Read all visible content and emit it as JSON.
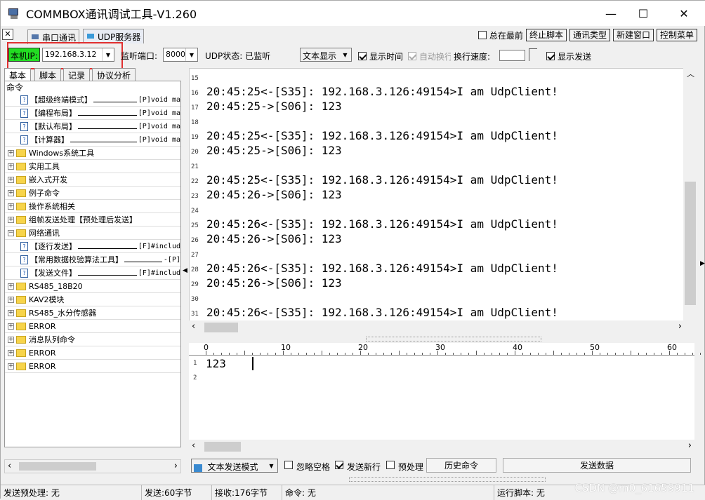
{
  "window": {
    "title": "COMMBOX通讯调试工具-V1.260"
  },
  "tabs": [
    {
      "label": "串口通讯"
    },
    {
      "label": "UDP服务器"
    }
  ],
  "top_right": {
    "always_on_top": "总在最前",
    "buttons": [
      "终止脚本",
      "通讯类型",
      "新建窗口",
      "控制菜单"
    ]
  },
  "toolbar": {
    "local_ip_label": "本机IP:",
    "local_ip_value": "192.168.3.12",
    "listen_port_label": "监听端口:",
    "listen_port_value": "8000",
    "udp_status": "UDP状态: 已监听",
    "display_mode": "文本显示",
    "show_time": "显示时间",
    "auto_wrap": "自动换行",
    "wrap_speed_label": "换行速度:",
    "show_send": "显示发送"
  },
  "left_tabs": [
    {
      "label": "基本"
    },
    {
      "label": "脚本"
    },
    {
      "label": "记录"
    },
    {
      "label": "协议分析"
    }
  ],
  "tree": {
    "header": "命令",
    "items": [
      {
        "kind": "doc",
        "label": "【超级终端模式】",
        "tail": "[P]void ma"
      },
      {
        "kind": "doc",
        "label": "【编程布局】",
        "tail": "[P]void ma"
      },
      {
        "kind": "doc",
        "label": "【默认布局】",
        "tail": "[P]void ma"
      },
      {
        "kind": "doc",
        "label": "【计算器】",
        "tail": "[P]void ma"
      },
      {
        "kind": "folder",
        "label": "Windows系统工具",
        "tail": ""
      },
      {
        "kind": "folder",
        "label": "实用工具",
        "tail": ""
      },
      {
        "kind": "folder",
        "label": "嵌入式开发",
        "tail": ""
      },
      {
        "kind": "folder",
        "label": "例子命令",
        "tail": ""
      },
      {
        "kind": "folder",
        "label": "操作系统相关",
        "tail": ""
      },
      {
        "kind": "folder",
        "label": "组帧发送处理【预处理后发送】",
        "tail": ""
      },
      {
        "kind": "folder-open",
        "label": "网络通讯",
        "tail": ""
      },
      {
        "kind": "doc",
        "label": "【逐行发送】",
        "tail": "[F]#includ"
      },
      {
        "kind": "doc",
        "label": "【常用数据校验算法工具】",
        "tail": "-[P]"
      },
      {
        "kind": "doc",
        "label": "【发送文件】",
        "tail": "[F]#includ"
      },
      {
        "kind": "folder",
        "label": "RS485_18B20",
        "tail": ""
      },
      {
        "kind": "folder",
        "label": "KAV2模块",
        "tail": ""
      },
      {
        "kind": "folder",
        "label": "RS485_水分传感器",
        "tail": ""
      },
      {
        "kind": "folder",
        "label": "ERROR",
        "tail": ""
      },
      {
        "kind": "folder",
        "label": "消息队列命令",
        "tail": ""
      },
      {
        "kind": "folder",
        "label": "ERROR",
        "tail": ""
      },
      {
        "kind": "folder",
        "label": "ERROR",
        "tail": ""
      }
    ]
  },
  "output": {
    "lines": [
      {
        "n": "15",
        "text": ""
      },
      {
        "n": "16",
        "text": "20:45:25<-[S35]: 192.168.3.126:49154>I am UdpClient!"
      },
      {
        "n": "17",
        "text": "20:45:25->[S06]: 123"
      },
      {
        "n": "18",
        "text": ""
      },
      {
        "n": "19",
        "text": "20:45:25<-[S35]: 192.168.3.126:49154>I am UdpClient!"
      },
      {
        "n": "20",
        "text": "20:45:25->[S06]: 123"
      },
      {
        "n": "21",
        "text": ""
      },
      {
        "n": "22",
        "text": "20:45:25<-[S35]: 192.168.3.126:49154>I am UdpClient!"
      },
      {
        "n": "23",
        "text": "20:45:26->[S06]: 123"
      },
      {
        "n": "24",
        "text": ""
      },
      {
        "n": "25",
        "text": "20:45:26<-[S35]: 192.168.3.126:49154>I am UdpClient!"
      },
      {
        "n": "26",
        "text": "20:45:26->[S06]: 123"
      },
      {
        "n": "27",
        "text": ""
      },
      {
        "n": "28",
        "text": "20:45:26<-[S35]: 192.168.3.126:49154>I am UdpClient!"
      },
      {
        "n": "29",
        "text": "20:45:26->[S06]: 123"
      },
      {
        "n": "30",
        "text": ""
      },
      {
        "n": "31",
        "text": "20:45:26<-[S35]: 192.168.3.126:49154>I am UdpClient!"
      }
    ]
  },
  "ruler": {
    "ticks": [
      "0",
      "10",
      "20",
      "30",
      "40",
      "50",
      "60"
    ]
  },
  "input": {
    "lines": [
      {
        "n": "1",
        "text": "123"
      },
      {
        "n": "2",
        "text": ""
      }
    ]
  },
  "send_bar": {
    "mode": "文本发送模式",
    "ignore_space": "忽略空格",
    "send_newline": "发送新行",
    "preprocess": "预处理",
    "history": "历史命令",
    "send": "发送数据"
  },
  "status": {
    "pre": "发送预处理: 无",
    "sent": "发送:60字节",
    "recv": "接收:176字节",
    "cmd": "命令: 无",
    "script": "运行脚本: 无"
  },
  "watermark": "CSDN @m0_61659911"
}
